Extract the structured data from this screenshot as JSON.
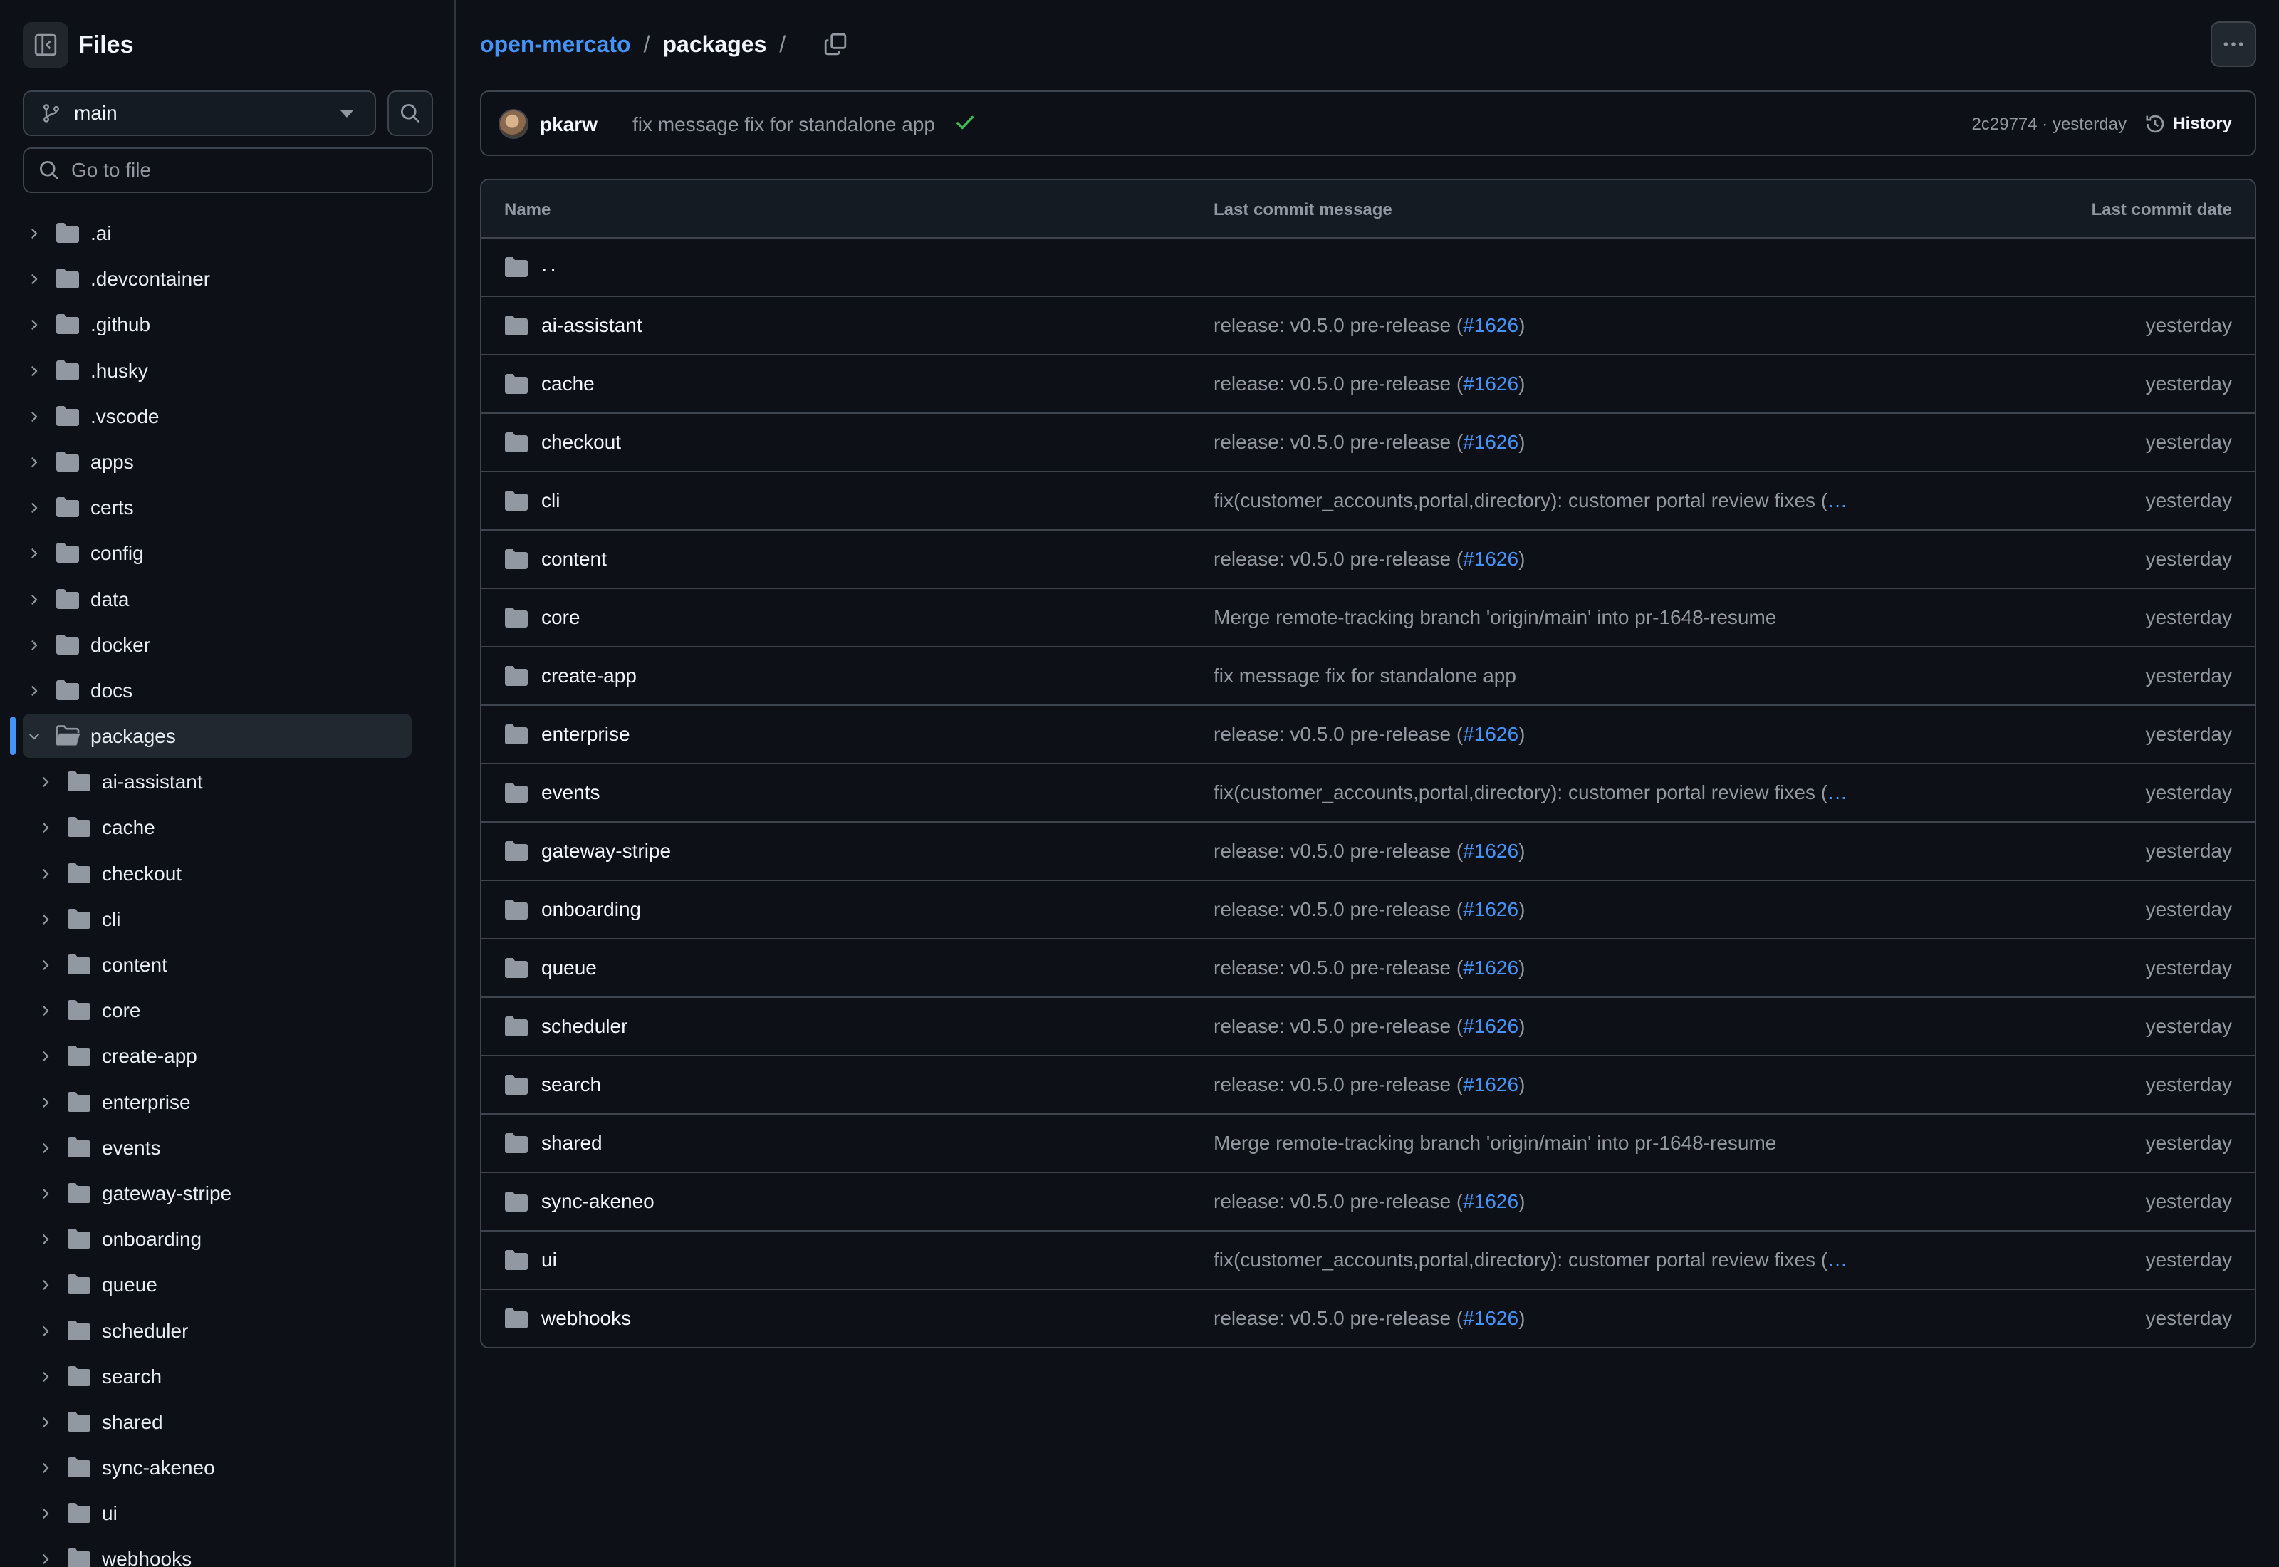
{
  "sidebar": {
    "title": "Files",
    "branch": "main",
    "goto_placeholder": "Go to file",
    "tree": [
      {
        "label": ".ai",
        "level": 0,
        "expanded": false
      },
      {
        "label": ".devcontainer",
        "level": 0,
        "expanded": false
      },
      {
        "label": ".github",
        "level": 0,
        "expanded": false
      },
      {
        "label": ".husky",
        "level": 0,
        "expanded": false
      },
      {
        "label": ".vscode",
        "level": 0,
        "expanded": false
      },
      {
        "label": "apps",
        "level": 0,
        "expanded": false
      },
      {
        "label": "certs",
        "level": 0,
        "expanded": false
      },
      {
        "label": "config",
        "level": 0,
        "expanded": false
      },
      {
        "label": "data",
        "level": 0,
        "expanded": false
      },
      {
        "label": "docker",
        "level": 0,
        "expanded": false
      },
      {
        "label": "docs",
        "level": 0,
        "expanded": false
      },
      {
        "label": "packages",
        "level": 0,
        "expanded": true,
        "selected": true
      },
      {
        "label": "ai-assistant",
        "level": 1,
        "expanded": false
      },
      {
        "label": "cache",
        "level": 1,
        "expanded": false
      },
      {
        "label": "checkout",
        "level": 1,
        "expanded": false
      },
      {
        "label": "cli",
        "level": 1,
        "expanded": false
      },
      {
        "label": "content",
        "level": 1,
        "expanded": false
      },
      {
        "label": "core",
        "level": 1,
        "expanded": false
      },
      {
        "label": "create-app",
        "level": 1,
        "expanded": false
      },
      {
        "label": "enterprise",
        "level": 1,
        "expanded": false
      },
      {
        "label": "events",
        "level": 1,
        "expanded": false
      },
      {
        "label": "gateway-stripe",
        "level": 1,
        "expanded": false
      },
      {
        "label": "onboarding",
        "level": 1,
        "expanded": false
      },
      {
        "label": "queue",
        "level": 1,
        "expanded": false
      },
      {
        "label": "scheduler",
        "level": 1,
        "expanded": false
      },
      {
        "label": "search",
        "level": 1,
        "expanded": false
      },
      {
        "label": "shared",
        "level": 1,
        "expanded": false
      },
      {
        "label": "sync-akeneo",
        "level": 1,
        "expanded": false
      },
      {
        "label": "ui",
        "level": 1,
        "expanded": false
      },
      {
        "label": "webhooks",
        "level": 1,
        "expanded": false
      }
    ]
  },
  "breadcrumb": {
    "repo": "open-mercato",
    "sep": "/",
    "current": "packages",
    "trailing_sep": "/"
  },
  "commit": {
    "author": "pkarw",
    "message": "fix message fix for standalone app",
    "status": "success",
    "meta": "2c29774 · yesterday",
    "history_label": "History"
  },
  "table": {
    "headers": {
      "name": "Name",
      "message": "Last commit message",
      "date": "Last commit date"
    },
    "parent_label": "..",
    "rows": [
      {
        "name": "ai-assistant",
        "message": "release: v0.5.0 pre-release (",
        "link": "#1626",
        "suffix": ")",
        "date": "yesterday"
      },
      {
        "name": "cache",
        "message": "release: v0.5.0 pre-release (",
        "link": "#1626",
        "suffix": ")",
        "date": "yesterday"
      },
      {
        "name": "checkout",
        "message": "release: v0.5.0 pre-release (",
        "link": "#1626",
        "suffix": ")",
        "date": "yesterday"
      },
      {
        "name": "cli",
        "message": "fix(customer_accounts,portal,directory): customer portal review fixes (",
        "link": "…",
        "suffix": "",
        "date": "yesterday"
      },
      {
        "name": "content",
        "message": "release: v0.5.0 pre-release (",
        "link": "#1626",
        "suffix": ")",
        "date": "yesterday"
      },
      {
        "name": "core",
        "message": "Merge remote-tracking branch 'origin/main' into pr-1648-resume",
        "link": "",
        "suffix": "",
        "date": "yesterday"
      },
      {
        "name": "create-app",
        "message": "fix message fix for standalone app",
        "link": "",
        "suffix": "",
        "date": "yesterday"
      },
      {
        "name": "enterprise",
        "message": "release: v0.5.0 pre-release (",
        "link": "#1626",
        "suffix": ")",
        "date": "yesterday"
      },
      {
        "name": "events",
        "message": "fix(customer_accounts,portal,directory): customer portal review fixes (",
        "link": "…",
        "suffix": "",
        "date": "yesterday"
      },
      {
        "name": "gateway-stripe",
        "message": "release: v0.5.0 pre-release (",
        "link": "#1626",
        "suffix": ")",
        "date": "yesterday"
      },
      {
        "name": "onboarding",
        "message": "release: v0.5.0 pre-release (",
        "link": "#1626",
        "suffix": ")",
        "date": "yesterday"
      },
      {
        "name": "queue",
        "message": "release: v0.5.0 pre-release (",
        "link": "#1626",
        "suffix": ")",
        "date": "yesterday"
      },
      {
        "name": "scheduler",
        "message": "release: v0.5.0 pre-release (",
        "link": "#1626",
        "suffix": ")",
        "date": "yesterday"
      },
      {
        "name": "search",
        "message": "release: v0.5.0 pre-release (",
        "link": "#1626",
        "suffix": ")",
        "date": "yesterday"
      },
      {
        "name": "shared",
        "message": "Merge remote-tracking branch 'origin/main' into pr-1648-resume",
        "link": "",
        "suffix": "",
        "date": "yesterday"
      },
      {
        "name": "sync-akeneo",
        "message": "release: v0.5.0 pre-release (",
        "link": "#1626",
        "suffix": ")",
        "date": "yesterday"
      },
      {
        "name": "ui",
        "message": "fix(customer_accounts,portal,directory): customer portal review fixes (",
        "link": "…",
        "suffix": "",
        "date": "yesterday"
      },
      {
        "name": "webhooks",
        "message": "release: v0.5.0 pre-release (",
        "link": "#1626",
        "suffix": ")",
        "date": "yesterday"
      }
    ]
  },
  "colors": {
    "background": "#0d1117",
    "border": "#3d444d",
    "link": "#4493f8",
    "muted": "#9198a1",
    "success": "#3fb950",
    "folder": "#9198a1"
  },
  "icons": {
    "sidebar_toggle": "sidebar-collapse-icon",
    "branch": "git-branch-icon",
    "search": "search-icon",
    "chevron": "chevron-right-icon",
    "folder": "folder-icon",
    "folder_open": "folder-open-icon",
    "copy": "copy-icon",
    "more": "kebab-horizontal-icon",
    "check": "check-icon",
    "history": "history-icon"
  }
}
